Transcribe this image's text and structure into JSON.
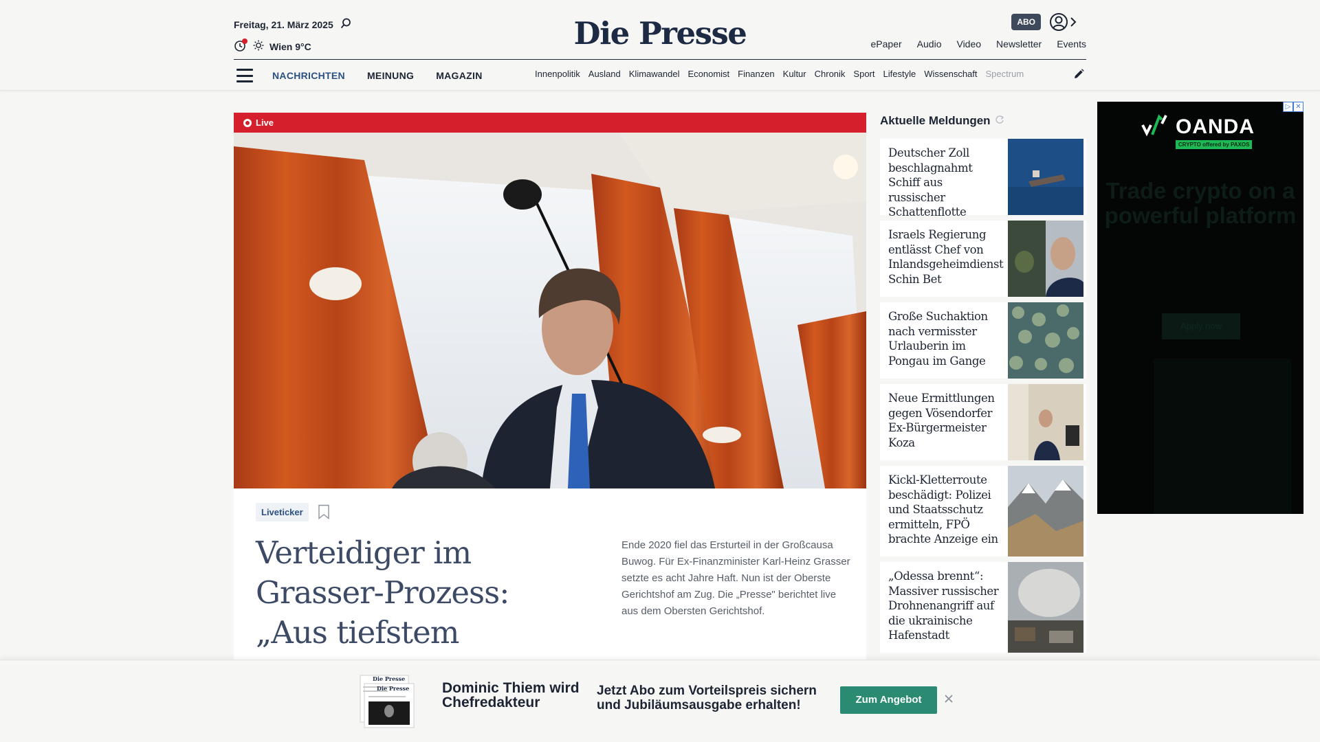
{
  "header": {
    "date": "Freitag, 21. März 2025",
    "weather": "Wien 9°C",
    "logo": "Die Presse",
    "abo_label": "ABO",
    "top_links": [
      "ePaper",
      "Audio",
      "Video",
      "Newsletter",
      "Events"
    ],
    "main_nav": [
      {
        "label": "NACHRICHTEN",
        "active": true
      },
      {
        "label": "MEINUNG",
        "active": false
      },
      {
        "label": "MAGAZIN",
        "active": false
      }
    ],
    "sub_nav": [
      "Innenpolitik",
      "Ausland",
      "Klimawandel",
      "Economist",
      "Finanzen",
      "Kultur",
      "Chronik",
      "Sport",
      "Lifestyle",
      "Wissenschaft",
      "Spectrum"
    ]
  },
  "hero": {
    "live_label": "Live",
    "tag": "Liveticker",
    "headline": "Verteidiger im Grasser-Prozess: „Aus tiefstem Herzen“",
    "lead": "Ende 2020 fiel das Ersturteil in der Großcausa Buwog. Für Ex-Finanzminister Karl-Heinz Grasser setzte es acht Jahre Haft. Nun ist der Oberste Gerichtshof am Zug. Die „Presse\" berichtet live aus dem Obersten Gerichtshof."
  },
  "news": {
    "title": "Aktuelle Meldungen",
    "items": [
      {
        "headline": "Deutscher Zoll beschlagnahmt Schiff aus russischer Schattenflotte"
      },
      {
        "headline": "Israels Regierung entlässt Chef von Inlandsgeheimdienst Schin Bet"
      },
      {
        "headline": "Große Suchaktion nach vermisster Urlauberin im Pongau im Gange"
      },
      {
        "headline": "Neue Ermittlungen gegen Vösendorfer Ex-Bürgermeister Koza"
      },
      {
        "headline": "Kickl-Kletterroute beschädigt: Polizei und Staatsschutz ermitteln, FPÖ brachte Anzeige ein"
      },
      {
        "headline": "„Odessa brennt“: Massiver russischer Drohnenangriff auf die ukrainische Hafenstadt"
      }
    ]
  },
  "ad": {
    "brand": "OANDA",
    "sub": "CRYPTO offered by PAXOS",
    "tagline": "Trade crypto on a powerful platform",
    "button": "Apply now"
  },
  "banner": {
    "title": "Dominic Thiem wird Chefredakteur",
    "text": "Jetzt Abo zum Vorteilspreis sichern und Jubiläumsausgabe erhalten!",
    "button": "Zum Angebot",
    "paper_logo": "Die Presse"
  },
  "colors": {
    "brand_navy": "#1d2a44",
    "nav_active": "#2a5083",
    "live_red": "#d61f2c",
    "cta_green": "#2b8a72"
  }
}
